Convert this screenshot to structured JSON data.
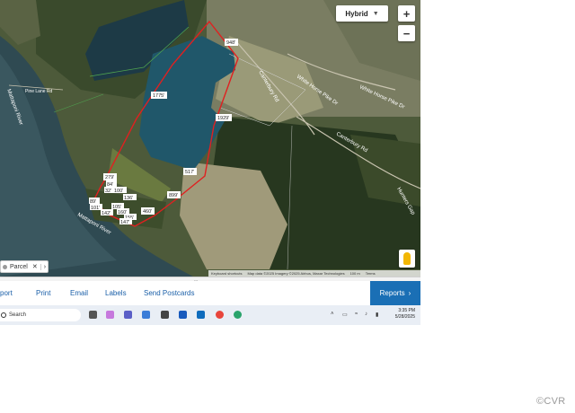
{
  "map": {
    "map_type": "Hybrid",
    "zoom_in": "+",
    "zoom_out": "−",
    "roads": [
      "Canterbury Rd",
      "White Horse Pike Dr",
      "White Horse Pike Dr",
      "Canterbury Rd",
      "Hunters Gap"
    ],
    "rivers": [
      "Mattaponi River",
      "Mattaponi River"
    ],
    "place": "Pine Lane Rd",
    "dimensions": [
      "948'",
      "1775'",
      "1929'",
      "517'",
      "899'",
      "460'",
      "279'",
      "84'",
      "32'",
      "100'",
      "136'",
      "105'",
      "160'",
      "155'",
      "147'",
      "142'",
      "89'",
      "101'"
    ],
    "parcel_chip": "Parcel",
    "attribution": {
      "shortcuts": "Keyboard shortcuts",
      "mapdata": "Map data ©2025 Imagery ©2025 Airbus, Maxar Technologies",
      "scale": "100 m",
      "terms": "Terms"
    }
  },
  "actions": {
    "export": "port",
    "print": "Print",
    "email": "Email",
    "labels": "Labels",
    "postcards": "Send Postcards",
    "reports": "Reports"
  },
  "taskbar": {
    "search": "Search",
    "time": "3:35 PM",
    "date": "5/28/2025"
  },
  "watermark": "©CVR",
  "colors": {
    "boundary": "#e02020",
    "accent": "#1a6fb5"
  }
}
